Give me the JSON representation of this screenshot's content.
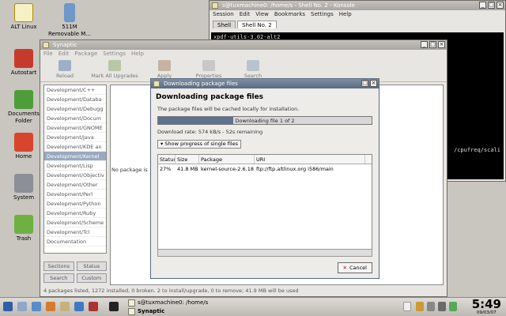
{
  "desktop": {
    "icons": [
      {
        "label": "ALT Linux"
      },
      {
        "label": "511M\nRemovable M..."
      },
      {
        "label": "Autostart"
      },
      {
        "label": "Documents\nFolder"
      },
      {
        "label": "Home"
      },
      {
        "label": "System"
      },
      {
        "label": "Trash"
      }
    ]
  },
  "konsole": {
    "title": "s@tuxmachine0: /home/s - Shell No. 2 - Konsole",
    "menu": [
      "Session",
      "Edit",
      "View",
      "Bookmarks",
      "Settings",
      "Help"
    ],
    "tabs": [
      "Shell",
      "Shell No. 2"
    ],
    "terminal_line1": "xpdf-utils-3.02-alt2",
    "terminal_line2": "/cpufreq/scali"
  },
  "synaptic": {
    "title": "Synaptic",
    "menu": [
      "File",
      "Edit",
      "Package",
      "Settings",
      "Help"
    ],
    "toolbar": [
      "Reload",
      "Mark All Upgrades",
      "Apply",
      "Properties",
      "Search"
    ],
    "sections": [
      "Development/C++",
      "Development/Databa",
      "Development/Debugg",
      "Development/Docum",
      "Development/GNOME",
      "Development/Java",
      "Development/KDE an",
      "Development/Kernel",
      "Development/Lisp",
      "Development/Objectiv",
      "Development/Other",
      "Development/Perl",
      "Development/Python",
      "Development/Ruby",
      "Development/Scheme",
      "Development/Tcl",
      "Documentation"
    ],
    "selected_section": "Development/Kernel",
    "filter_buttons": [
      "Sections",
      "Status",
      "Search",
      "Custom"
    ],
    "no_package_text": "No package is",
    "status_text": "4 packages listed, 1272 installed, 0 broken. 2 to install/upgrade, 0 to remove; 41.9 MB will be used"
  },
  "download_dialog": {
    "title": "Downloading package files",
    "heading": "Downloading package files",
    "info": "The package files will be cached locally for installation.",
    "progress_text": "Downloading file 1 of 2",
    "progress": 0.35,
    "rate": "Download rate: 574 kB/s - 52s remaining",
    "expander_label": "Show progress of single files",
    "columns": [
      "Status",
      "Size",
      "Package",
      "URI"
    ],
    "rows": [
      {
        "status": "27%",
        "size": "41.8 MB",
        "package": "kernel-source-2.6.18",
        "uri": "ftp://ftp.altlinux.org i586/main kerne"
      }
    ],
    "cancel_label": "Cancel"
  },
  "taskbar": {
    "tasks": [
      "s@tuxmachine0: /home/s",
      "Synaptic"
    ],
    "time": "5:49",
    "date": "09/03/07"
  }
}
